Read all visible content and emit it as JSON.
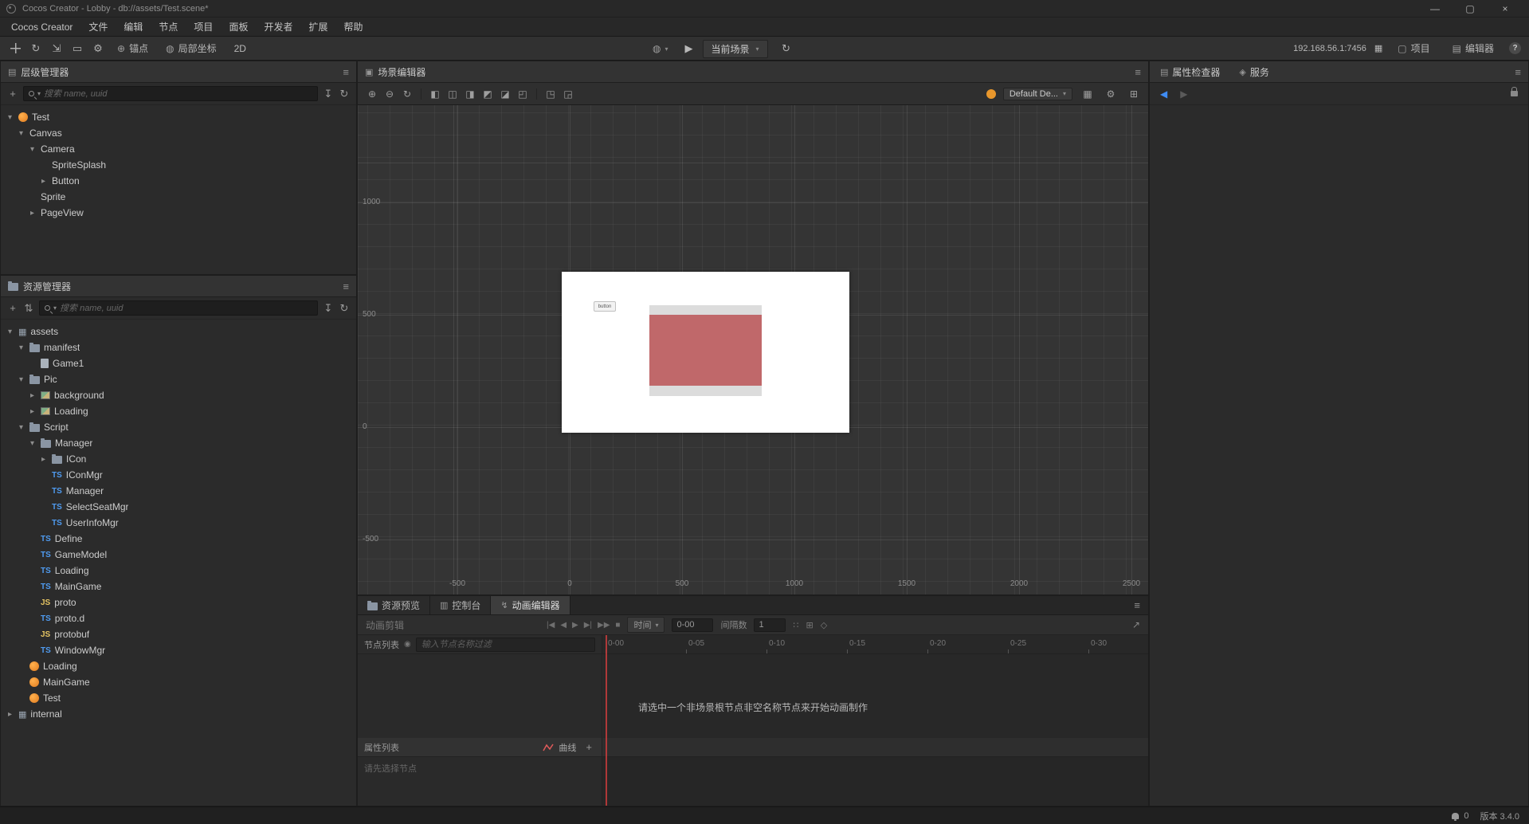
{
  "titlebar": {
    "title": "Cocos Creator - Lobby - db://assets/Test.scene*"
  },
  "menubar": {
    "items": [
      "Cocos Creator",
      "文件",
      "编辑",
      "节点",
      "项目",
      "面板",
      "开发者",
      "扩展",
      "帮助"
    ]
  },
  "toolbar": {
    "anchor_label": "锚点",
    "coords_label": "局部坐标",
    "mode_label": "2D",
    "scene_select": "当前场景",
    "address": "192.168.56.1:7456",
    "project_label": "项目",
    "editor_label": "编辑器"
  },
  "hierarchy": {
    "title": "层级管理器",
    "search_placeholder": "搜索 name, uuid",
    "tree": [
      {
        "label": "Test",
        "indent": 0,
        "arrow": "down",
        "icon": "cocos"
      },
      {
        "label": "Canvas",
        "indent": 1,
        "arrow": "down",
        "icon": null
      },
      {
        "label": "Camera",
        "indent": 2,
        "arrow": "down",
        "icon": null
      },
      {
        "label": "SpriteSplash",
        "indent": 3,
        "arrow": null,
        "icon": null
      },
      {
        "label": "Button",
        "indent": 3,
        "arrow": "right",
        "icon": null
      },
      {
        "label": "Sprite",
        "indent": 2,
        "arrow": null,
        "icon": null
      },
      {
        "label": "PageView",
        "indent": 2,
        "arrow": "right",
        "icon": null
      }
    ]
  },
  "assets": {
    "title": "资源管理器",
    "search_placeholder": "搜索 name, uuid",
    "tree": [
      {
        "label": "assets",
        "indent": 0,
        "arrow": "down",
        "icon": "db"
      },
      {
        "label": "manifest",
        "indent": 1,
        "arrow": "down",
        "icon": "folder"
      },
      {
        "label": "Game1",
        "indent": 2,
        "arrow": null,
        "icon": "file"
      },
      {
        "label": "Pic",
        "indent": 1,
        "arrow": "down",
        "icon": "folder"
      },
      {
        "label": "background",
        "indent": 2,
        "arrow": "right",
        "icon": "img"
      },
      {
        "label": "Loading",
        "indent": 2,
        "arrow": "right",
        "icon": "img"
      },
      {
        "label": "Script",
        "indent": 1,
        "arrow": "down",
        "icon": "folder"
      },
      {
        "label": "Manager",
        "indent": 2,
        "arrow": "down",
        "icon": "folder"
      },
      {
        "label": "ICon",
        "indent": 3,
        "arrow": "right",
        "icon": "folder"
      },
      {
        "label": "IConMgr",
        "indent": 3,
        "arrow": null,
        "icon": "ts"
      },
      {
        "label": "Manager",
        "indent": 3,
        "arrow": null,
        "icon": "ts"
      },
      {
        "label": "SelectSeatMgr",
        "indent": 3,
        "arrow": null,
        "icon": "ts"
      },
      {
        "label": "UserInfoMgr",
        "indent": 3,
        "arrow": null,
        "icon": "ts"
      },
      {
        "label": "Define",
        "indent": 2,
        "arrow": null,
        "icon": "ts"
      },
      {
        "label": "GameModel",
        "indent": 2,
        "arrow": null,
        "icon": "ts"
      },
      {
        "label": "Loading",
        "indent": 2,
        "arrow": null,
        "icon": "ts"
      },
      {
        "label": "MainGame",
        "indent": 2,
        "arrow": null,
        "icon": "ts"
      },
      {
        "label": "proto",
        "indent": 2,
        "arrow": null,
        "icon": "js"
      },
      {
        "label": "proto.d",
        "indent": 2,
        "arrow": null,
        "icon": "ts"
      },
      {
        "label": "protobuf",
        "indent": 2,
        "arrow": null,
        "icon": "js"
      },
      {
        "label": "WindowMgr",
        "indent": 2,
        "arrow": null,
        "icon": "ts"
      },
      {
        "label": "Loading",
        "indent": 1,
        "arrow": null,
        "icon": "cocos"
      },
      {
        "label": "MainGame",
        "indent": 1,
        "arrow": null,
        "icon": "cocos"
      },
      {
        "label": "Test",
        "indent": 1,
        "arrow": null,
        "icon": "cocos"
      },
      {
        "label": "internal",
        "indent": 0,
        "arrow": "right",
        "icon": "db"
      }
    ]
  },
  "scene": {
    "title": "场景编辑器",
    "device_select": "Default De...",
    "ruler_left": [
      "1000",
      "500",
      "0",
      "-500"
    ],
    "ruler_bottom": [
      "-500",
      "0",
      "500",
      "1000",
      "1500",
      "2000",
      "2500"
    ],
    "button_label": "button",
    "colors": {
      "sprite_red": "#c0686a",
      "sprite_gray": "#dcdcdc",
      "frame": "#ffffff"
    }
  },
  "bottom": {
    "tabs": [
      {
        "label": "资源预览"
      },
      {
        "label": "控制台"
      },
      {
        "label": "动画编辑器"
      }
    ],
    "clip_label": "动画剪辑",
    "time_label": "时间",
    "time_value": "0-00",
    "interval_label": "间隔数",
    "interval_value": "1",
    "node_list_label": "节点列表",
    "node_search_placeholder": "输入节点名称过滤",
    "timeline_ticks": [
      "0-00",
      "0-05",
      "0-10",
      "0-15",
      "0-20",
      "0-25",
      "0-30"
    ],
    "empty_message": "请选中一个非场景根节点非空名称节点来开始动画制作",
    "property_list_label": "属性列表",
    "curve_label": "曲线",
    "select_node_hint": "请先选择节点"
  },
  "inspector": {
    "tab_inspector": "属性检查器",
    "tab_service": "服务"
  },
  "statusbar": {
    "notification_count": "0",
    "version": "版本 3.4.0"
  },
  "icons": {
    "hamburger": "≡",
    "plus": "+",
    "refresh": "↻",
    "collapse": "↧",
    "sort": "⇅",
    "arrow_down": "▾",
    "arrow_right": "▸",
    "minimize": "—",
    "maximize": "▢",
    "close": "×",
    "play": "▶",
    "globe": "◍",
    "zoom_in": "⊕",
    "zoom_out": "⊖",
    "rotate_tool": "↻",
    "scale_tool": "⇲",
    "rect_tool": "▭",
    "gear": "⚙",
    "anchor": "⊕",
    "cube": "◇",
    "grid": "▦",
    "panel_list": "▤",
    "scene_tab": "▣",
    "console_tab": "▥",
    "animation_tab": "↯",
    "service_tab": "◈",
    "expand": "⊞",
    "align_icons": [
      "◧",
      "◫",
      "◨",
      "◩",
      "◪",
      "◰",
      "◳",
      "◲"
    ],
    "playback": [
      "|◀",
      "◀",
      "▶",
      "▶|",
      "▶▶",
      "■"
    ],
    "kf_icons": [
      "∷",
      "⊞",
      "◇"
    ],
    "export": "↗",
    "help": "?",
    "qr": "▦",
    "project": "▢",
    "editor": "▤",
    "eye": "◉",
    "prev": "◀",
    "next": "▶"
  }
}
